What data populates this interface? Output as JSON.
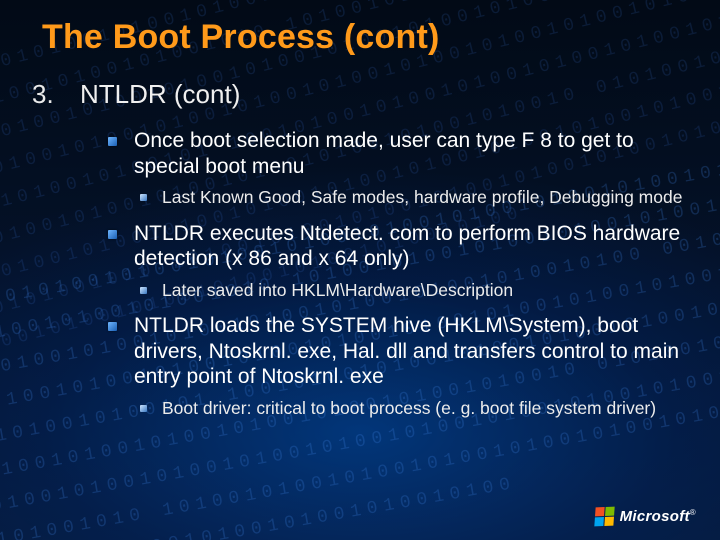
{
  "title": "The Boot Process (cont)",
  "list_number": "3.",
  "subtitle": "NTLDR (cont)",
  "bullets": {
    "b0": "Once boot selection made, user can type F 8 to get to special boot menu",
    "b0_0": "Last Known Good, Safe modes, hardware profile, Debugging mode",
    "b1": "NTLDR executes Ntdetect. com to perform BIOS hardware detection (x 86 and x 64 only)",
    "b1_0": "Later saved into HKLM\\Hardware\\Description",
    "b2": "NTLDR loads the SYSTEM hive (HKLM\\System), boot drivers, Ntoskrnl. exe, Hal. dll and transfers control to main entry point of Ntoskrnl. exe",
    "b2_0": "Boot driver: critical to boot process (e. g. boot file system driver)"
  },
  "brand": "Microsoft"
}
